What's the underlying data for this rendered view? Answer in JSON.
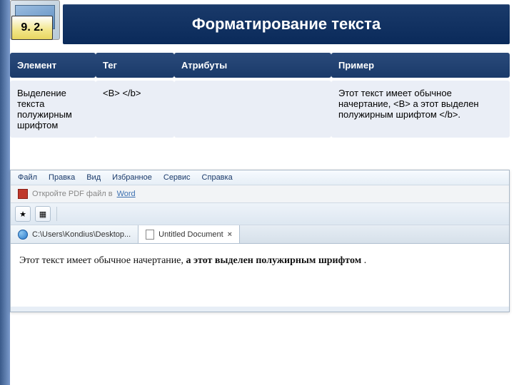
{
  "section_number": "9. 2.",
  "title": "Форматирование текста",
  "table": {
    "headers": [
      "Элемент",
      "Тег",
      "Атрибуты",
      "Пример"
    ],
    "row": {
      "element": "Выделение текста полужирным шрифтом",
      "tag": "<B> </b>",
      "attributes": "",
      "example": "Этот текст имеет обычное начертание, <B> а этот выделен полужирным шрифтом </b>."
    }
  },
  "browser": {
    "menu": [
      "Файл",
      "Правка",
      "Вид",
      "Избранное",
      "Сервис",
      "Справка"
    ],
    "pdf_prompt_prefix": "Откройте PDF файл в",
    "pdf_prompt_link": "Word",
    "tabs": [
      {
        "label": "C:\\Users\\Kondius\\Desktop...",
        "active": false,
        "icon": "ie"
      },
      {
        "label": "Untitled Document",
        "active": true,
        "icon": "doc"
      }
    ],
    "page": {
      "normal_text": "Этот текст имеет обычное начертание, ",
      "bold_text": "а этот выделен полужирным шрифтом",
      "tail": " ."
    }
  }
}
